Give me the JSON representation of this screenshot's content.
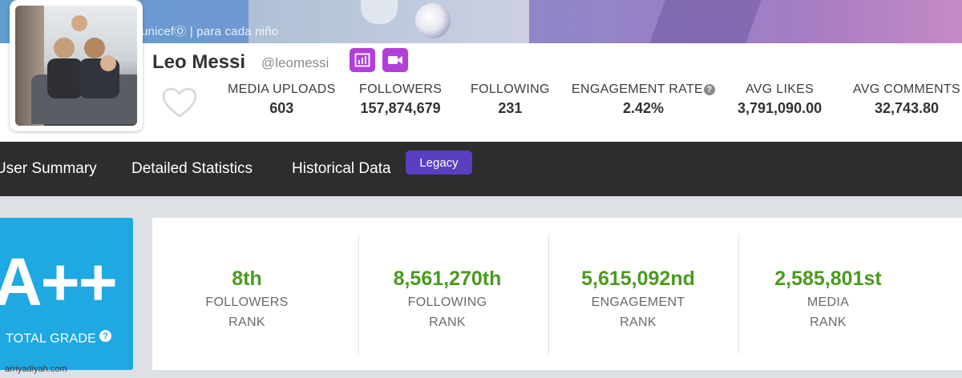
{
  "banner": {
    "overlay_text": "unicefⓄ | para cada niño"
  },
  "profile": {
    "name": "Leo Messi",
    "handle": "@leomessi",
    "badges": [
      "bar-chart-icon",
      "video-camera-icon"
    ]
  },
  "stats": [
    {
      "label": "MEDIA UPLOADS",
      "value": "603"
    },
    {
      "label": "FOLLOWERS",
      "value": "157,874,679"
    },
    {
      "label": "FOLLOWING",
      "value": "231"
    },
    {
      "label": "ENGAGEMENT RATE",
      "value": "2.42%"
    },
    {
      "label": "AVG LIKES",
      "value": "3,791,090.00"
    },
    {
      "label": "AVG COMMENTS",
      "value": "32,743.80"
    }
  ],
  "nav": {
    "tabs": [
      "User Summary",
      "Detailed Statistics",
      "Historical Data"
    ],
    "legacy_badge": "Legacy"
  },
  "grade": {
    "value": "A++",
    "label": "TOTAL GRADE"
  },
  "ranks": [
    {
      "value": "8th",
      "line1": "FOLLOWERS",
      "line2": "RANK"
    },
    {
      "value": "8,561,270th",
      "line1": "FOLLOWING",
      "line2": "RANK"
    },
    {
      "value": "5,615,092nd",
      "line1": "ENGAGEMENT",
      "line2": "RANK"
    },
    {
      "value": "2,585,801st",
      "line1": "MEDIA",
      "line2": "RANK"
    }
  ],
  "colors": {
    "accent_purple": "#b23fd9",
    "legacy_purple": "#5a3fc0",
    "grade_blue": "#1fa8e2",
    "rank_green": "#4a9a1e",
    "nav_dark": "#2d2d2d"
  },
  "watermark": "arriyadiyah.com"
}
